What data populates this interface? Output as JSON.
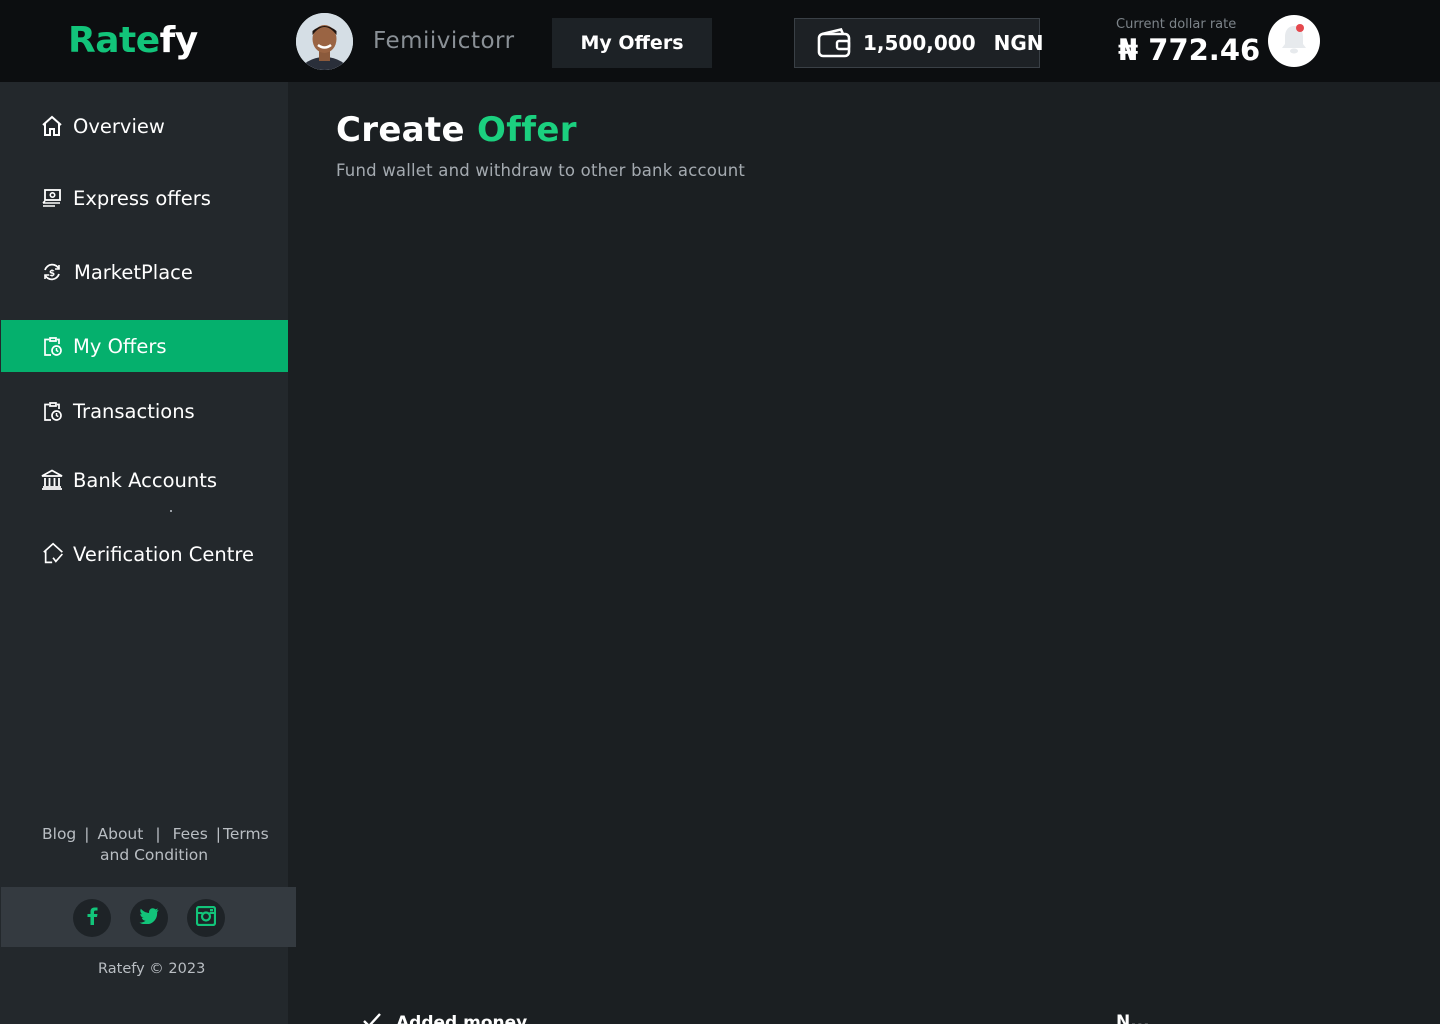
{
  "brand": {
    "logo_part1": "Rate",
    "logo_part2": "fy"
  },
  "header": {
    "username": "Femiivictorr",
    "active_tab": "My Offers",
    "wallet_amount": "1,500,000",
    "wallet_currency": "NGN",
    "rate_label": "Current dollar rate",
    "rate_value": "₦ 772.46"
  },
  "sidebar": {
    "items": [
      {
        "label": "Overview",
        "icon": "home-icon"
      },
      {
        "label": "Express offers",
        "icon": "money-exchange-icon"
      },
      {
        "label": "MarketPlace",
        "icon": "currency-cycle-icon"
      },
      {
        "label": "My Offers",
        "icon": "clipboard-clock-icon",
        "active": true
      },
      {
        "label": "Transactions",
        "icon": "clipboard-clock-icon"
      },
      {
        "label": "Bank Accounts",
        "icon": "bank-icon"
      },
      {
        "label": "Verification Centre",
        "icon": "house-check-icon"
      }
    ],
    "footer_links": [
      "Blog",
      "About",
      "Fees",
      "Terms"
    ],
    "footer_links_cont": "and Condition",
    "separator": "|",
    "social": [
      "facebook-icon",
      "twitter-icon",
      "instagram-icon"
    ],
    "copyright": "Ratefy © 2023"
  },
  "main": {
    "title_part1": "Create",
    "title_part2": "Offer",
    "subtitle": "Fund wallet and withdraw to other bank account",
    "cutoff_left": "Added money",
    "cutoff_right": "N..."
  },
  "colors": {
    "accent": "#05b06d",
    "accent_text": "#1bd07f",
    "topbar": "#0c0e10",
    "sidebar": "#23282c",
    "main_bg": "#1b1f22"
  }
}
